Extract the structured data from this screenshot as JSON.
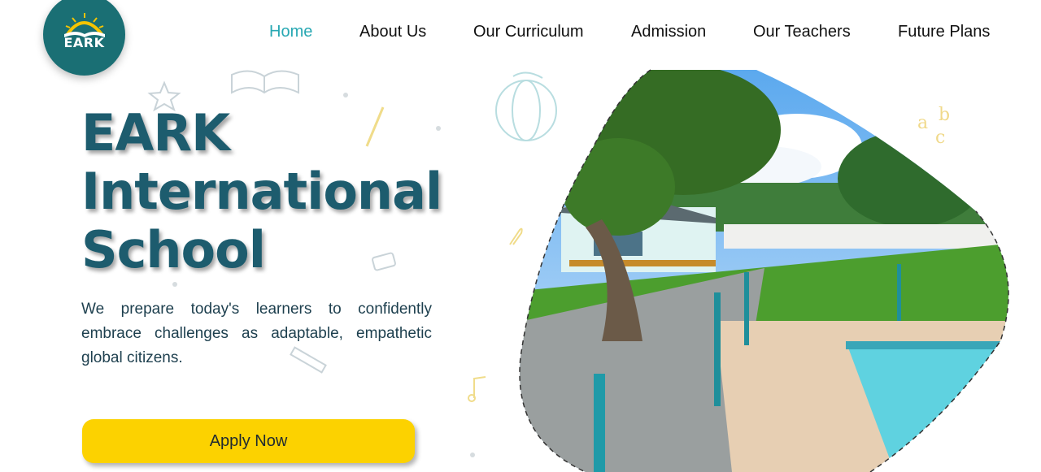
{
  "logo": {
    "text": "EARK",
    "icon": "school-logo-sunrise-book"
  },
  "nav": {
    "items": [
      {
        "label": "Home",
        "active": true
      },
      {
        "label": "About Us"
      },
      {
        "label": "Our Curriculum"
      },
      {
        "label": "Admission"
      },
      {
        "label": "Our Teachers"
      },
      {
        "label": "Future Plans"
      }
    ]
  },
  "hero": {
    "title_line1": "EARK",
    "title_line2": "International",
    "title_line3": "School",
    "description": "We prepare today's learners to confidently embrace challenges as adaptable, empathetic global citizens.",
    "cta_label": "Apply Now"
  },
  "colors": {
    "accent": "#28a8b3",
    "title": "#1d5c6e",
    "button": "#fcd200",
    "logo_bg": "#1a6f74"
  }
}
